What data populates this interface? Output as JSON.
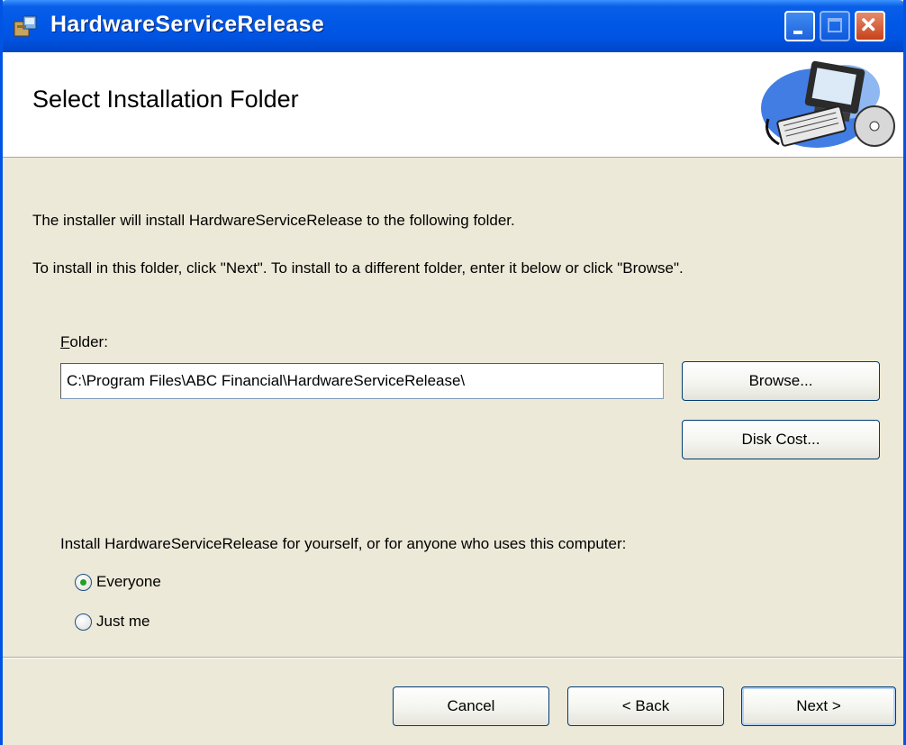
{
  "window": {
    "title": "HardwareServiceRelease"
  },
  "header": {
    "title": "Select Installation Folder"
  },
  "body": {
    "line1": "The installer will install HardwareServiceRelease to the following folder.",
    "line2": "To install in this folder, click \"Next\". To install to a different folder, enter it below or click \"Browse\"."
  },
  "folder": {
    "label_mnemonic": "F",
    "label_rest": "older:",
    "value": "C:\\Program Files\\ABC Financial\\HardwareServiceRelease\\"
  },
  "buttons": {
    "browse": "Browse...",
    "disk_cost": "Disk Cost...",
    "cancel": "Cancel",
    "back": "< Back",
    "next": "Next >"
  },
  "install_for": {
    "prompt": "Install HardwareServiceRelease for yourself, or for anyone who uses this computer:",
    "options": [
      {
        "label": "Everyone",
        "selected": true
      },
      {
        "label": "Just me",
        "selected": false
      }
    ]
  },
  "icons": {
    "app": "installer-package-icon",
    "banner": "computer-with-cd-icon",
    "minimize": "minimize-icon",
    "maximize": "maximize-icon",
    "close": "close-icon"
  },
  "colors": {
    "titlebar": "#0054E3",
    "dialog_bg": "#ECE9D8",
    "radio_dot": "#21A121"
  }
}
